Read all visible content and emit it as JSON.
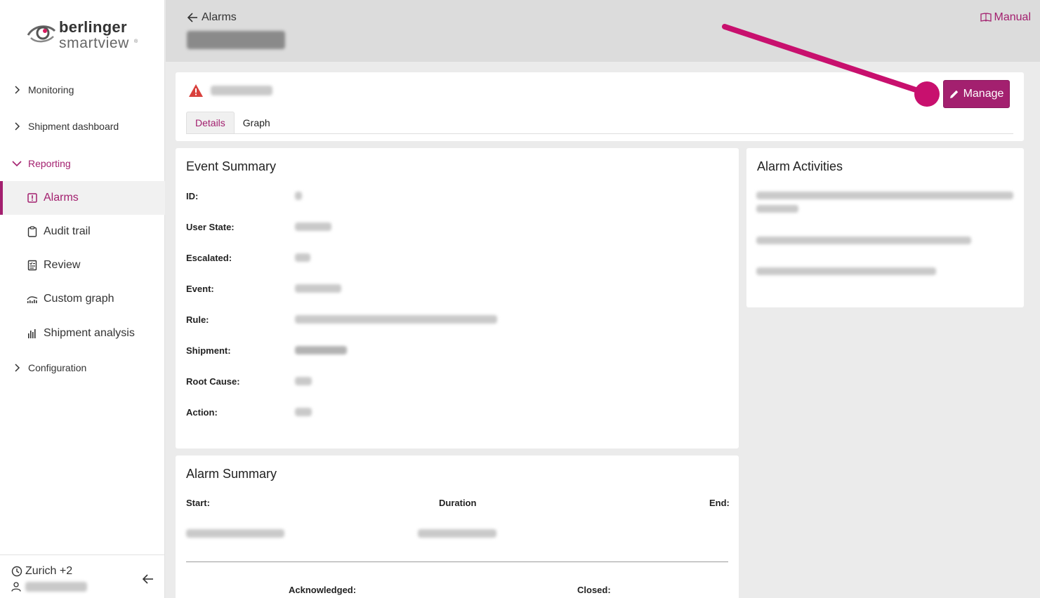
{
  "sidebar": {
    "brand_top": "berlinger",
    "brand_bottom": "smartview",
    "brand_reg": "®",
    "sections": {
      "monitoring": "Monitoring",
      "shipment_dashboard": "Shipment dashboard",
      "reporting": "Reporting",
      "configuration": "Configuration"
    },
    "items": {
      "alarms": "Alarms",
      "audit_trail": "Audit trail",
      "review": "Review",
      "custom_graph": "Custom graph",
      "shipment_analysis": "Shipment analysis"
    },
    "footer": {
      "timezone": "Zurich +2"
    }
  },
  "header": {
    "back_label": "Alarms",
    "manual_label": "Manual"
  },
  "top_card": {
    "manage_label": "Manage",
    "tabs": {
      "details": "Details",
      "graph": "Graph"
    }
  },
  "event_summary": {
    "title": "Event Summary",
    "labels": {
      "id": "ID:",
      "user_state": "User State:",
      "escalated": "Escalated:",
      "event": "Event:",
      "rule": "Rule:",
      "shipment": "Shipment:",
      "root_cause": "Root Cause:",
      "action": "Action:"
    }
  },
  "alarm_activities": {
    "title": "Alarm Activities"
  },
  "alarm_summary": {
    "title": "Alarm Summary",
    "labels": {
      "start": "Start:",
      "duration": "Duration",
      "end": "End:",
      "acknowledged": "Acknowledged:",
      "closed": "Closed:"
    }
  },
  "colors": {
    "accent": "#a3206f",
    "annotation": "#c8106e",
    "warning": "#d9413d",
    "header_bg": "#dcdcdc",
    "page_bg": "#ebebeb"
  }
}
